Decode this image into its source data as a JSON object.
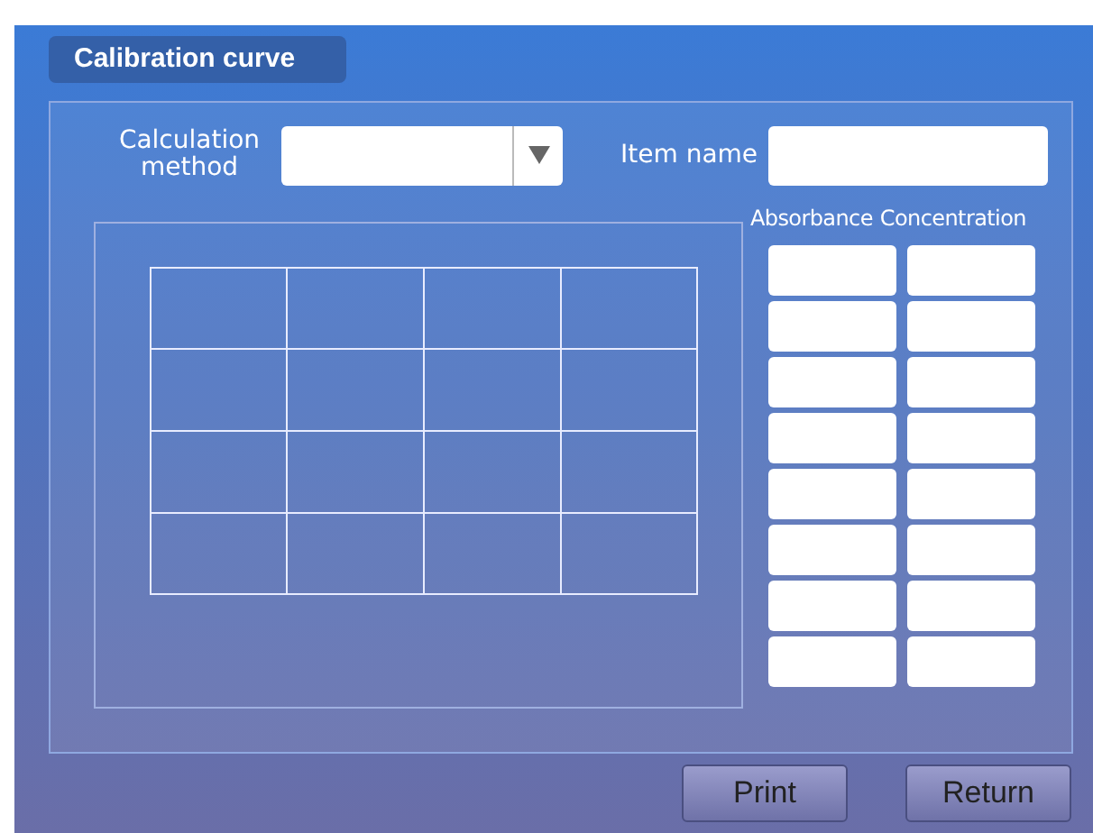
{
  "title": "Calibration curve",
  "form": {
    "method_label": "Calculation method",
    "item_label": "Item name"
  },
  "table": {
    "columns": [
      "Absorbance",
      "Concentration"
    ]
  },
  "buttons": [
    "Print",
    "Return"
  ]
}
